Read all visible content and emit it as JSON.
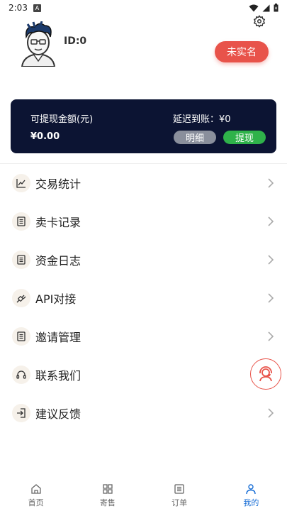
{
  "status_bar": {
    "time": "2:03",
    "notif_letter": "A"
  },
  "profile": {
    "id_text": "ID:0",
    "verify_label": "未实名"
  },
  "balance_card": {
    "withdrawable_label": "可提现金额(元)",
    "withdrawable_value": "¥0.00",
    "delayed_label": "延迟到账：¥0",
    "detail_button": "明细",
    "withdraw_button": "提现"
  },
  "menu": {
    "items": [
      {
        "label": "交易统计",
        "icon": "chart-icon"
      },
      {
        "label": "卖卡记录",
        "icon": "document-icon"
      },
      {
        "label": "资金日志",
        "icon": "document-icon"
      },
      {
        "label": "API对接",
        "icon": "plug-icon"
      },
      {
        "label": "邀请管理",
        "icon": "document-icon"
      },
      {
        "label": "联系我们",
        "icon": "headset-icon"
      },
      {
        "label": "建议反馈",
        "icon": "login-arrow-icon"
      }
    ]
  },
  "bottom_nav": {
    "items": [
      {
        "label": "首页",
        "icon": "home-icon"
      },
      {
        "label": "寄售",
        "icon": "grid-icon"
      },
      {
        "label": "订单",
        "icon": "list-icon"
      },
      {
        "label": "我的",
        "icon": "person-icon"
      }
    ],
    "active_index": 3
  },
  "colors": {
    "accent": "#1a6fd6",
    "danger": "#e8534a",
    "card_bg": "#0c1433",
    "success": "#2fb24a"
  }
}
